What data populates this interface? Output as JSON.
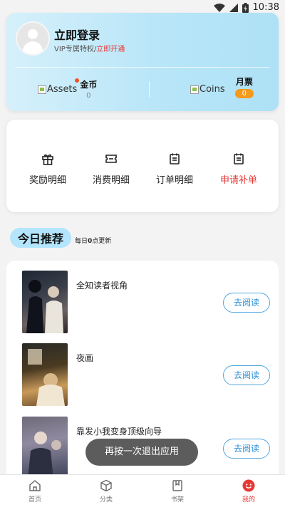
{
  "status_bar": {
    "time": "10:38"
  },
  "profile": {
    "login_title": "立即登录",
    "vip_prefix": "VIP专属特权/",
    "vip_link": "立即开通",
    "coins": {
      "img_alt": "Assets",
      "label": "金币",
      "value": "0"
    },
    "tickets": {
      "img_alt": "Coins",
      "label": "月票",
      "value": "0"
    }
  },
  "menu": {
    "items": [
      {
        "label": "奖励明细",
        "icon": "gift-icon"
      },
      {
        "label": "消费明细",
        "icon": "ticket-icon"
      },
      {
        "label": "订单明细",
        "icon": "order-list-icon"
      },
      {
        "label": "申请补单",
        "icon": "apply-list-icon"
      }
    ],
    "accent_color": "#e53935"
  },
  "recommend": {
    "title": "今日推荐",
    "note_prefix": "每日",
    "note_bold": "0",
    "note_suffix": "点更新",
    "read_label": "去阅读",
    "books": [
      {
        "title": "全知读者视角"
      },
      {
        "title": "夜画"
      },
      {
        "title": "靠发小我变身顶级向导"
      }
    ]
  },
  "toast": "再按一次退出应用",
  "tabs": [
    {
      "label": "首页",
      "icon": "home-icon",
      "active": false
    },
    {
      "label": "分类",
      "icon": "category-icon",
      "active": false
    },
    {
      "label": "书架",
      "icon": "bookshelf-icon",
      "active": false
    },
    {
      "label": "我的",
      "icon": "mine-icon",
      "active": true
    }
  ]
}
